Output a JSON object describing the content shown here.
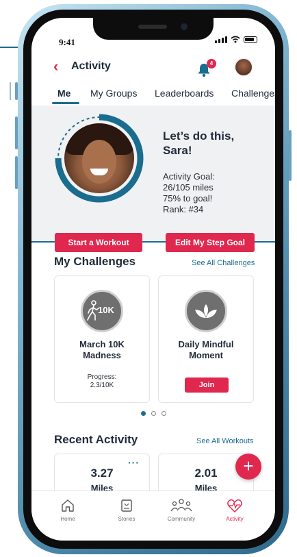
{
  "status": {
    "time": "9:41"
  },
  "header": {
    "title": "Activity",
    "notification_count": "4"
  },
  "tabs": [
    {
      "label": "Me",
      "active": true
    },
    {
      "label": "My Groups",
      "active": false
    },
    {
      "label": "Leaderboards",
      "active": false
    },
    {
      "label": "Challenges",
      "active": false
    }
  ],
  "hero": {
    "greeting": "Let’s do this, Sara!",
    "goal_label": "Activity Goal:",
    "goal_value": "26/105 miles",
    "goal_percent": "75% to goal!",
    "rank": "Rank: #34",
    "start_workout": "Start a Workout",
    "edit_goal": "Edit My Step Goal"
  },
  "challenges": {
    "title": "My Challenges",
    "see_all": "See All Challenges",
    "items": [
      {
        "badge": "10K",
        "icon": "walker-icon",
        "name": "March 10K Madness",
        "progress_label": "Progress:",
        "progress_value": "2.3/10K"
      },
      {
        "icon": "lotus-icon",
        "name": "Daily Mindful Moment",
        "join": "Join"
      }
    ]
  },
  "recent": {
    "title": "Recent Activity",
    "see_all": "See All Workouts",
    "items": [
      {
        "value": "3.27",
        "unit": "Miles"
      },
      {
        "value": "2.01",
        "unit": "Miles"
      }
    ]
  },
  "nav": [
    {
      "label": "Home",
      "icon": "home-icon"
    },
    {
      "label": "Stories",
      "icon": "stories-icon"
    },
    {
      "label": "Community",
      "icon": "community-icon"
    },
    {
      "label": "Activity",
      "icon": "activity-icon",
      "active": true
    }
  ],
  "colors": {
    "accent": "#e0284f",
    "brand": "#1a6d8e",
    "text": "#1f2b3a"
  }
}
